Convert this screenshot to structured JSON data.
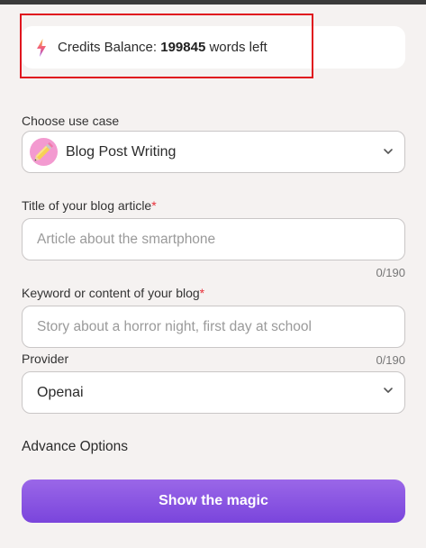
{
  "credits": {
    "prefix": "Credits Balance: ",
    "value": "199845",
    "suffix": " words left",
    "icon": "lightning-bolt-icon"
  },
  "use_case": {
    "label": "Choose use case",
    "selected": "Blog Post Writing",
    "icon": "pencil-icon"
  },
  "title_field": {
    "label": "Title of your blog article",
    "required_mark": "*",
    "placeholder": "Article about the smartphone",
    "counter": "0/190"
  },
  "keyword_field": {
    "label": "Keyword or content of your blog",
    "required_mark": "*",
    "placeholder": "Story about a horror night, first day at school",
    "counter": "0/190"
  },
  "provider": {
    "label": "Provider",
    "selected": "Openai"
  },
  "advance_options": "Advance Options",
  "submit_label": "Show the magic",
  "colors": {
    "accent": "#8a55e2",
    "highlight_box": "#e0141e",
    "required": "#e8313a",
    "background": "#f5f2f1"
  }
}
